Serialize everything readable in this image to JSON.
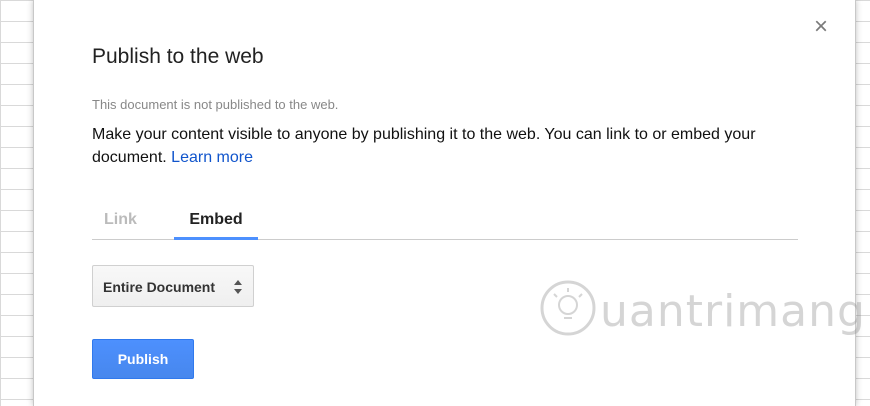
{
  "dialog": {
    "title": "Publish to the web",
    "status": "This document is not published to the web.",
    "description": "Make your content visible to anyone by publishing it to the web. You can link to or embed your document.",
    "learn_more": "Learn more",
    "close_icon": "close-icon"
  },
  "tabs": [
    {
      "label": "Link",
      "active": false
    },
    {
      "label": "Embed",
      "active": true
    }
  ],
  "select": {
    "value": "Entire Document",
    "icon": "up-down-arrows-icon"
  },
  "publish_button": {
    "label": "Publish"
  },
  "watermark": {
    "text": "uantrimang"
  },
  "colors": {
    "accent": "#4d90fe",
    "link": "#1155cc",
    "inactive_tab": "#bbbbbb"
  }
}
